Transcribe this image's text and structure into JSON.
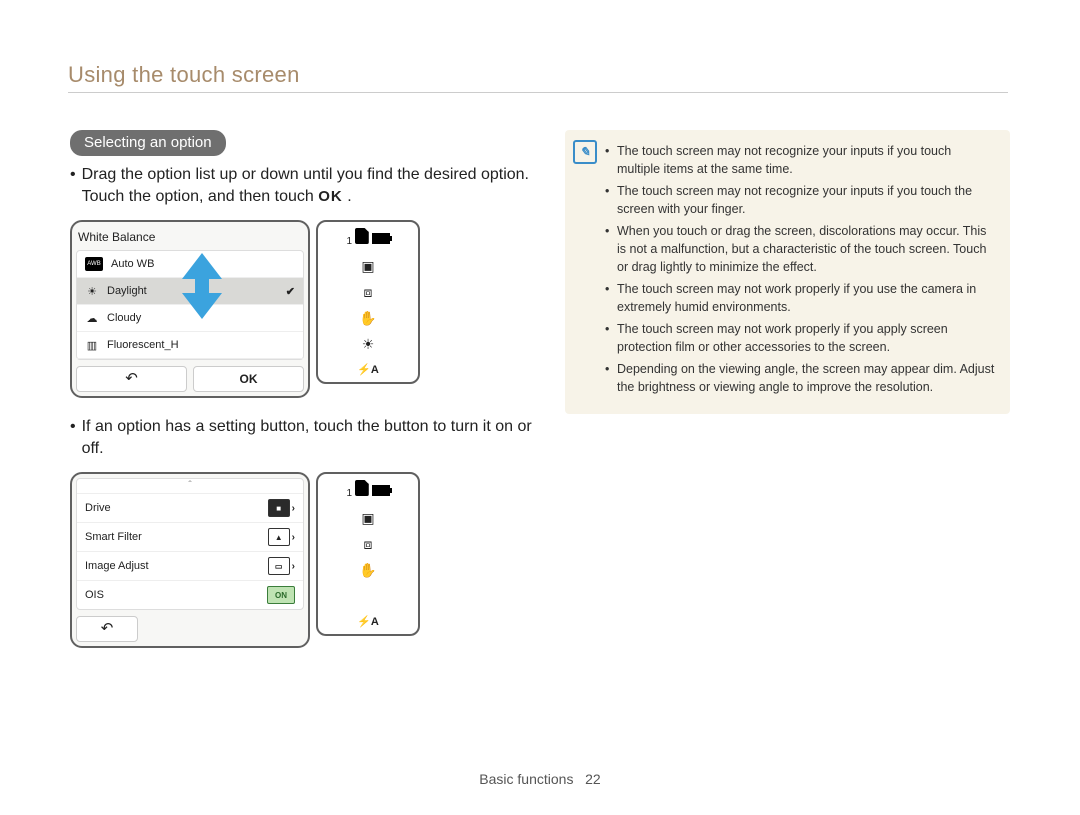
{
  "page": {
    "title": "Using the touch screen",
    "footer_section": "Basic functions",
    "footer_page": "22"
  },
  "section": {
    "heading": "Selecting an option",
    "para1_a": "Drag the option list up or down until you find the desired option. Touch the option, and then touch ",
    "para1_ok": "OK",
    "para1_b": ".",
    "para2": "If an option has a setting button, touch the button to turn it on or off."
  },
  "fig1": {
    "title": "White Balance",
    "items": [
      {
        "icon": "AWB",
        "label": "Auto WB"
      },
      {
        "icon": "sun",
        "label": "Daylight",
        "selected": true
      },
      {
        "icon": "cloud",
        "label": "Cloudy"
      },
      {
        "icon": "fluor",
        "label": "Fluorescent_H"
      }
    ],
    "ok": "OK"
  },
  "fig2": {
    "items": [
      {
        "label": "Drive",
        "kind": "single"
      },
      {
        "label": "Smart Filter",
        "kind": "normal"
      },
      {
        "label": "Image Adjust",
        "kind": "normal"
      },
      {
        "label": "OIS",
        "kind": "toggle",
        "toggle": "ON"
      }
    ]
  },
  "sidecol": {
    "top": "1",
    "flash": "A"
  },
  "note": {
    "items": [
      "The touch screen may not recognize your inputs if you touch multiple items at the same time.",
      "The touch screen may not recognize your inputs if you touch the screen with your finger.",
      "When you touch or drag the screen, discolorations may occur. This is not a malfunction, but a characteristic of the touch screen. Touch or drag lightly to minimize the effect.",
      "The touch screen may not work properly if you use the camera in extremely humid environments.",
      "The touch screen may not work properly if you apply screen protection film or other accessories to the screen.",
      "Depending on the viewing angle, the screen may appear dim. Adjust the brightness or viewing angle to improve the resolution."
    ]
  }
}
